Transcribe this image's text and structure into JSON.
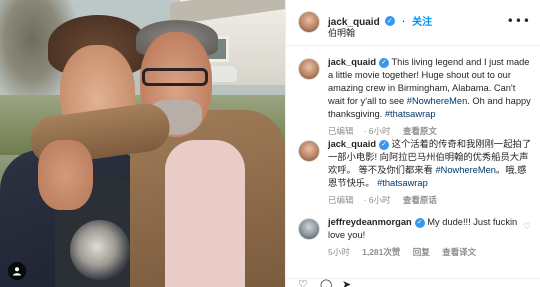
{
  "post": {
    "username": "jack_quaid",
    "follow_label": "关注",
    "subtitle": "伯明翰",
    "more_label": "•••"
  },
  "comments": [
    {
      "username": "jack_quaid",
      "text": "This living legend and I just made a little movie together! Huge shout out to our amazing crew in Birmingham, Alabama. Can't wait for y'all to see",
      "tag1": "#NowhereMen",
      "text2": ". Oh and happy thanksgiving.",
      "tag2": "#thatsawrap",
      "edited": "已编辑",
      "time": "6小时",
      "translate": "查看原文"
    },
    {
      "username": "jack_quaid",
      "text": "这个活着的传奇和我刚刚一起拍了一部小电影! 向阿拉巴马州伯明翰的优秀船员大声欢呼。 等不及你们都来看",
      "tag1": "#NowhereMen",
      "text2": "。哦,感恩节快乐。",
      "tag2": "#thatsawrap",
      "edited": "已编辑",
      "time": "6小时",
      "translate": "查看原话"
    },
    {
      "username": "jeffreydeanmorgan",
      "text": "My dude!!! Just fuckin love you!",
      "time": "5小时",
      "likes": "1,281次赞",
      "reply": "回复",
      "translate": "查看译文"
    }
  ],
  "icons": {
    "verified": "verified-badge-icon",
    "tag": "user-tag-icon",
    "more": "more-options-icon",
    "heart": "heart-icon"
  },
  "colors": {
    "link": "#00376b",
    "follow": "#0095f6",
    "verified": "#3897f0",
    "muted": "#8e8e8e"
  }
}
